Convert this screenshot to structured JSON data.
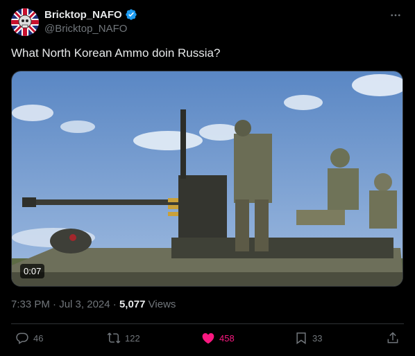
{
  "author": {
    "display_name": "Bricktop_NAFO",
    "handle": "@Bricktop_NAFO",
    "verified": true,
    "avatar_icon": "union-jack-skull-avatar"
  },
  "tweet": {
    "text": "What North Korean Ammo doin Russia?"
  },
  "media": {
    "type": "video",
    "duration": "0:07"
  },
  "meta": {
    "time": "7:33 PM",
    "separator": "·",
    "date": "Jul 3, 2024",
    "views_count": "5,077",
    "views_label": "Views"
  },
  "actions": {
    "replies": "46",
    "reposts": "122",
    "likes": "458",
    "bookmarks": "33"
  },
  "colors": {
    "background": "#000000",
    "text": "#e7e9ea",
    "muted": "#71767b",
    "like": "#f91880",
    "verified": "#1d9bf0"
  }
}
